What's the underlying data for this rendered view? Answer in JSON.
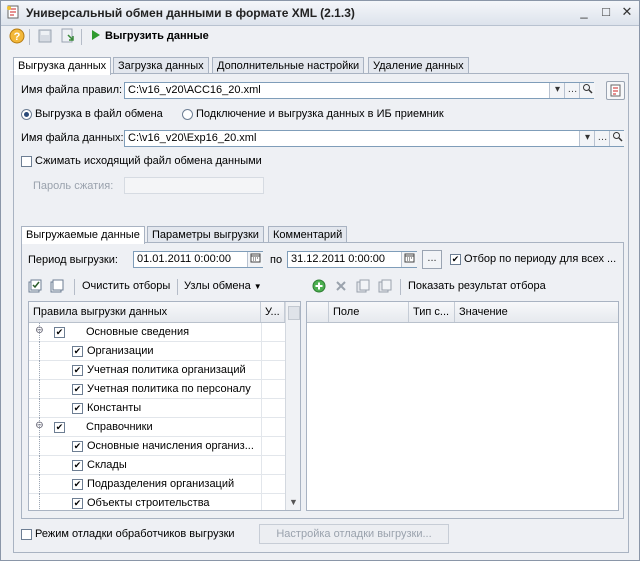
{
  "window": {
    "title": "Универсальный обмен данными в формате XML (2.1.3)",
    "controls": [
      "_",
      "□",
      "✕"
    ]
  },
  "toolbar": {
    "upload_label": "Выгрузить данные"
  },
  "main_tabs": [
    {
      "label": "Выгрузка данных",
      "active": true
    },
    {
      "label": "Загрузка данных",
      "active": false
    },
    {
      "label": "Дополнительные настройки",
      "active": false
    },
    {
      "label": "Удаление данных",
      "active": false
    }
  ],
  "rules_file": {
    "label": "Имя файла правил:",
    "value": "C:\\v16_v20\\ACC16_20.xml"
  },
  "mode": {
    "option1": "Выгрузка в файл обмена",
    "option2": "Подключение и выгрузка данных в ИБ приемник",
    "selected": "option1"
  },
  "data_file": {
    "label": "Имя файла данных:",
    "value": "C:\\v16_v20\\Exp16_20.xml"
  },
  "compress": {
    "label": "Сжимать исходящий файл обмена данными",
    "checked": false
  },
  "password": {
    "label": "Пароль сжатия:",
    "value": ""
  },
  "inner_tabs": [
    {
      "label": "Выгружаемые данные",
      "active": true
    },
    {
      "label": "Параметры выгрузки",
      "active": false
    },
    {
      "label": "Комментарий",
      "active": false
    }
  ],
  "period": {
    "label": "Период выгрузки:",
    "from": "01.01.2011  0:00:00",
    "to_label": "по",
    "to": "31.12.2011  0:00:00",
    "ellipsis": "...",
    "filter_label": "Отбор по периоду для всех ...",
    "filter_checked": true
  },
  "left_toolbar": {
    "clear_filters": "Очистить отборы",
    "nodes": "Узлы обмена"
  },
  "right_toolbar": {
    "show_result": "Показать результат отбора"
  },
  "rules_grid": {
    "columns": [
      "Правила выгрузки данных",
      "У..."
    ],
    "rows": [
      {
        "label": "Основные сведения",
        "group": true,
        "checked": true
      },
      {
        "label": "Организации",
        "group": false,
        "checked": true
      },
      {
        "label": "Учетная политика организаций",
        "group": false,
        "checked": true
      },
      {
        "label": "Учетная политика по персоналу",
        "group": false,
        "checked": true
      },
      {
        "label": "Константы",
        "group": false,
        "checked": true
      },
      {
        "label": "Справочники",
        "group": true,
        "checked": true
      },
      {
        "label": "Основные начисления организ...",
        "group": false,
        "checked": true
      },
      {
        "label": "Склады",
        "group": false,
        "checked": true
      },
      {
        "label": "Подразделения организаций",
        "group": false,
        "checked": true
      },
      {
        "label": "Объекты строительства",
        "group": false,
        "checked": true
      }
    ]
  },
  "filter_grid": {
    "columns": [
      "Поле",
      "Тип с...",
      "Значение"
    ]
  },
  "debug": {
    "label": "Режим отладки обработчиков выгрузки",
    "checked": false,
    "button": "Настройка отладки выгрузки..."
  },
  "colors": {
    "accent_green": "#2e9a2e",
    "help_orange": "#e8a020"
  }
}
